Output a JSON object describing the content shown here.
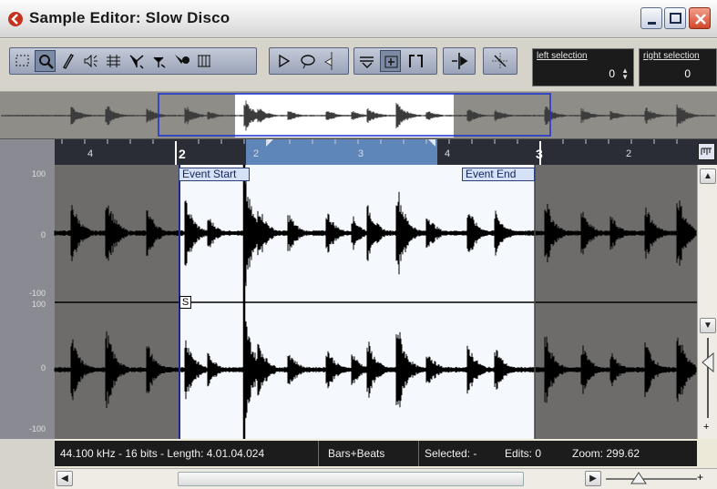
{
  "window": {
    "title": "Sample Editor: Slow Disco"
  },
  "toolbar": {
    "left_selection_label": "left selection",
    "left_selection_value": "0",
    "right_selection_label": "right selection",
    "right_selection_value": "0",
    "tools": [
      {
        "icon": "range-select-icon",
        "name": "tool-range-select",
        "active": false
      },
      {
        "icon": "zoom-icon",
        "name": "tool-zoom",
        "active": true
      },
      {
        "icon": "pencil-icon",
        "name": "tool-draw",
        "active": false
      },
      {
        "icon": "speaker-icon",
        "name": "tool-audition",
        "active": false
      },
      {
        "icon": "hitpoint-icon",
        "name": "tool-hitpoint",
        "active": false
      },
      {
        "icon": "warp-icon",
        "name": "tool-warp",
        "active": false
      },
      {
        "icon": "hand-icon",
        "name": "tool-scrub",
        "active": false
      },
      {
        "icon": "timewarp-icon",
        "name": "tool-timewarp",
        "active": false
      },
      {
        "icon": "grid-icon",
        "name": "tool-grid",
        "active": false
      }
    ]
  },
  "ruler": {
    "corner_label": "",
    "labels": [
      "4",
      "2",
      "2",
      "3",
      "4",
      "3",
      "2"
    ]
  },
  "waveform": {
    "y_labels_top": [
      "100",
      "0",
      "-100"
    ],
    "y_labels_bottom": [
      "100",
      "0",
      "-100"
    ],
    "event_start_label": "Event Start",
    "event_end_label": "Event End",
    "snap_label": "S",
    "colors": {
      "outside": "#6d6c6a",
      "inside": "#f5f8fd",
      "wave": "#000000"
    }
  },
  "status": {
    "format": "44.100 kHz - 16 bits - Length: 4.01.04.024",
    "time_format": "Bars+Beats",
    "selected": "Selected: -",
    "edits": "Edits: 0",
    "zoom": "Zoom: 299.62"
  }
}
